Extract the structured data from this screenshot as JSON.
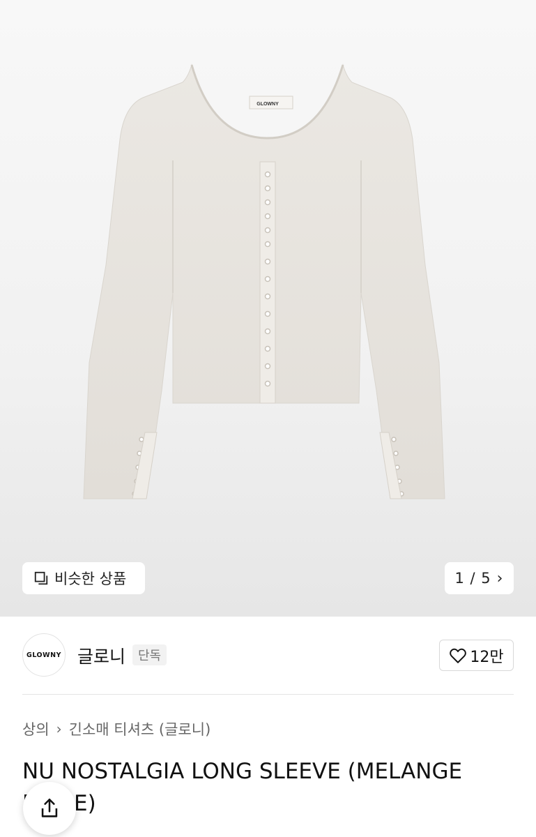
{
  "gallery": {
    "similar_label": "비슷한 상품",
    "counter": "1 / 5",
    "shirt_color": "#e8e4de",
    "garment_tag": "GLOWNY"
  },
  "store": {
    "logo_text": "GLOWNY",
    "name": "글로니",
    "badge": "단독",
    "likes": "12만"
  },
  "breadcrumb": {
    "parent": "상의",
    "child": "긴소매 티셔츠 (글로니)"
  },
  "product": {
    "title": "NU NOSTALGIA LONG SLEEVE (MELANGE BEIGE)"
  },
  "icons": {
    "similar": "copy-squares-icon",
    "next": "chevron-right-icon",
    "like": "heart-outline-icon",
    "share": "share-upload-icon"
  }
}
